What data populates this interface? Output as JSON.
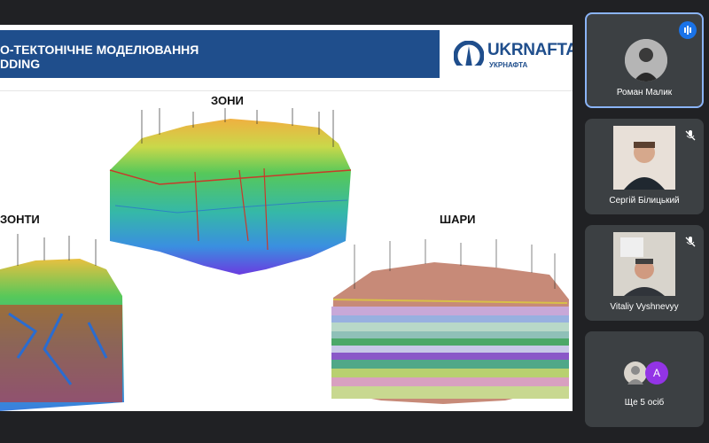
{
  "slide": {
    "title_line1": "О-ТЕКТОНІЧНЕ МОДЕЛЮВАННЯ",
    "title_line2": "DDING",
    "logo_brand": "UKRNAFTA",
    "logo_sub": "УКРНАФТА",
    "banner_color": "#1f4e8c",
    "labels": {
      "zones": "ЗОНИ",
      "zonti": "ЗОНТИ",
      "layers": "ШАРИ"
    }
  },
  "participants": [
    {
      "name": "Роман Малик",
      "status": "speaking"
    },
    {
      "name": "Сергій Білицький",
      "status": "muted"
    },
    {
      "name": "Vitaliy Vyshnevyy",
      "status": "muted"
    }
  ],
  "more": {
    "avatar_letter": "A",
    "label": "Ще 5 осіб"
  },
  "colors": {
    "background": "#202124",
    "tile": "#3c4043",
    "active_border": "#8ab4f8",
    "speaking_badge": "#1a73e8",
    "avatar_purple": "#9334e6"
  }
}
